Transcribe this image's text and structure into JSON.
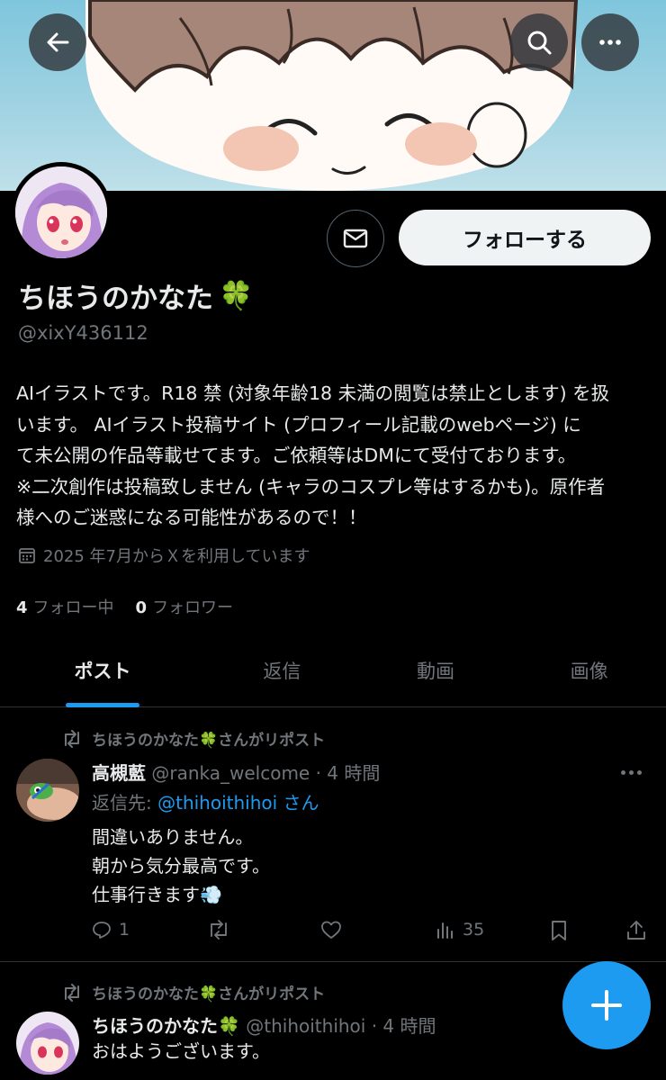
{
  "header": {
    "back_label": "back",
    "search_label": "search",
    "more_label": "more"
  },
  "profile": {
    "name": "ちほうのかなた",
    "name_emoji": "🍀",
    "handle": "@xixY436112",
    "bio": [
      "AIイラストです。R18 禁 (対象年齢18 未満の閲覧は禁止とします) を扱",
      "います。 AIイラスト投稿サイト (プロフィール記載のwebページ) に",
      "て未公開の作品等載せてます。ご依頼等はDMにて受付ております。",
      "※二次創作は投稿致しません (キャラのコスプレ等はするかも)。原作者",
      "様へのご迷惑になる可能性があるので！！"
    ],
    "joined": "2025 年7月からＸを利用しています",
    "following_count": "4",
    "following_label": "フォロー中",
    "followers_count": "0",
    "followers_label": "フォロワー",
    "follow_button": "フォローする"
  },
  "tabs": [
    {
      "label": "ポスト",
      "active": true
    },
    {
      "label": "返信",
      "active": false
    },
    {
      "label": "動画",
      "active": false
    },
    {
      "label": "画像",
      "active": false
    }
  ],
  "posts": [
    {
      "repost_text": "ちほうのかなた🍀さんがリポスト",
      "author": "高槻藍",
      "handle_time": "@ranka_welcome · 4 時間",
      "reply_prefix": "返信先: ",
      "reply_link": "@thihoithihoi さん",
      "lines": [
        "間違いありません。",
        "朝から気分最高です。",
        "仕事行きます💨"
      ],
      "replies": "1",
      "views": "35"
    },
    {
      "repost_text": "ちほうのかなた🍀さんがリポスト",
      "author": "ちほうのかなた🍀",
      "handle_time": "@thihoithihoi · 4 時間",
      "lines": [
        "おはようございます。"
      ]
    }
  ],
  "colors": {
    "accent": "#1d9bf0",
    "background": "#000000",
    "muted": "#71767b",
    "divider": "#2f3336"
  }
}
